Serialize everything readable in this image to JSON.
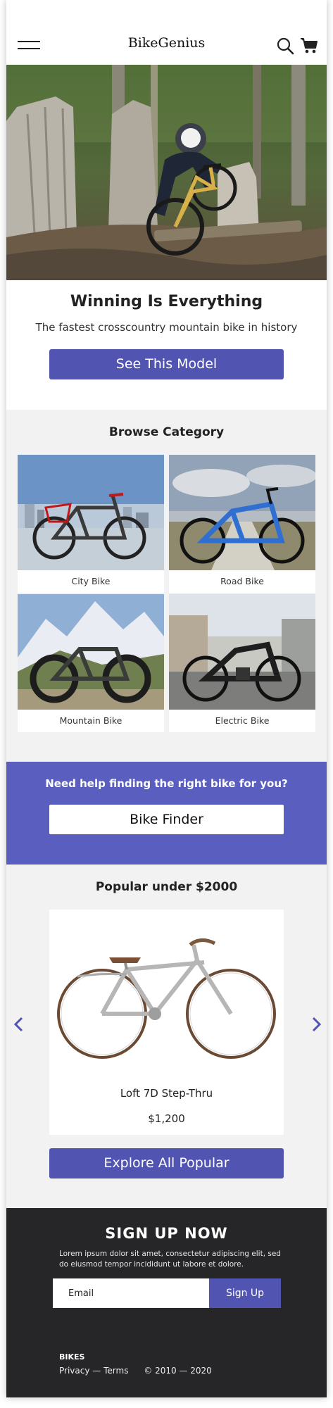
{
  "header": {
    "logo": "BikeGenius",
    "icons": [
      "menu-icon",
      "search-icon",
      "cart-icon"
    ]
  },
  "hero": {
    "title": "Winning Is Everything",
    "subtitle": "The fastest crosscountry mountain bike in history",
    "button_label": "See This Model"
  },
  "category": {
    "title": "Browse Category",
    "items": [
      {
        "label": "City Bike"
      },
      {
        "label": "Road Bike"
      },
      {
        "label": "Mountain Bike"
      },
      {
        "label": "Electric Bike"
      }
    ]
  },
  "finder": {
    "question": "Need help finding the right bike for you?",
    "button_label": "Bike Finder"
  },
  "popular": {
    "title": "Popular under $2000",
    "product_name": "Loft 7D Step-Thru",
    "product_price": "$1,200",
    "button_label": "Explore All Popular"
  },
  "footer": {
    "signup_title": "SIGN UP NOW",
    "signup_text": "Lorem ipsum dolor sit amet, consectetur adipiscing elit, sed do eiusmod tempor incididunt ut labore et dolore.",
    "email_placeholder": "Email",
    "signup_button": "Sign Up",
    "brand": "BIKES",
    "privacy_link": "Privacy",
    "separator": "—",
    "terms_link": "Terms",
    "copyright": "© 2010 — 2020"
  },
  "colors": {
    "accent": "#5254b1",
    "finder_band": "#5a5ebe",
    "footer_bg": "#262629",
    "section_bg": "#f2f2f2"
  }
}
